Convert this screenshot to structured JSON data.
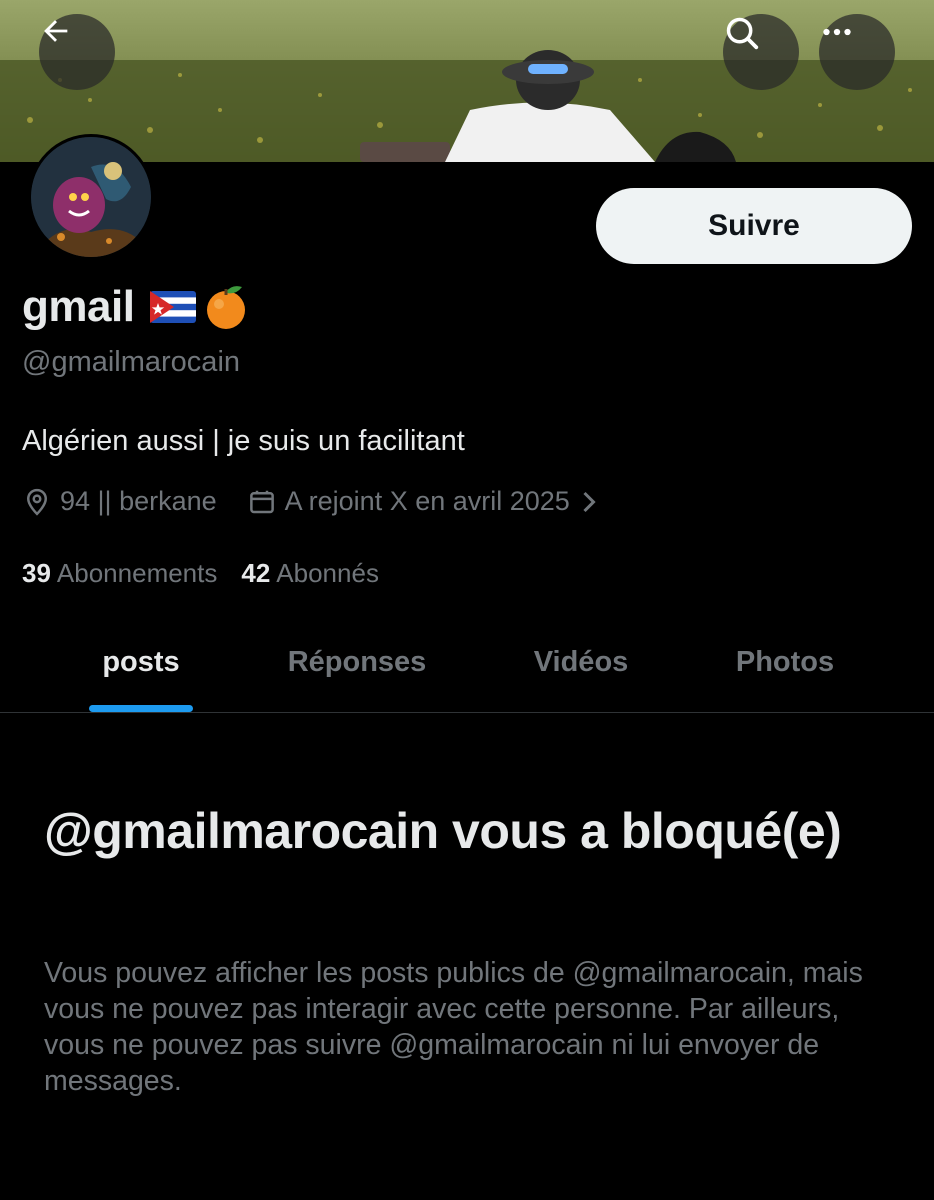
{
  "header": {
    "back_icon": "arrow-left-icon",
    "search_icon": "search-icon",
    "more_icon": "more-horizontal-icon"
  },
  "profile": {
    "display_name": "gmail",
    "name_emojis": [
      "cuba-flag",
      "tangerine"
    ],
    "handle": "@gmailmarocain",
    "bio": "Algérien aussi | je suis un facilitant",
    "location": "94 || berkane",
    "joined": "A rejoint X en avril 2025",
    "following_count": "39",
    "following_label": "Abonnements",
    "followers_count": "42",
    "followers_label": "Abonnés",
    "follow_label": "Suivre"
  },
  "tabs": [
    {
      "label": "posts",
      "active": true
    },
    {
      "label": "Réponses",
      "active": false
    },
    {
      "label": "Vidéos",
      "active": false
    },
    {
      "label": "Photos",
      "active": false
    }
  ],
  "blocked": {
    "title": "@gmailmarocain vous a bloqué(e)",
    "message": "Vous pouvez afficher les posts publics de @gmailmarocain, mais vous ne pouvez pas interagir avec cette personne. Par ailleurs, vous ne pouvez pas suivre @gmailmarocain ni lui envoyer de messages."
  },
  "colors": {
    "background": "#000000",
    "text_primary": "#e7e9ea",
    "text_secondary": "#71767b",
    "accent": "#1d9bf0",
    "follow_button_bg": "#eff3f4"
  }
}
